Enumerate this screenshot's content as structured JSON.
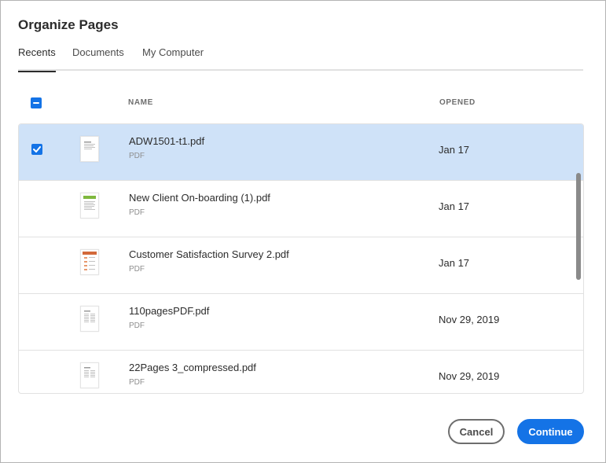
{
  "dialog": {
    "title": "Organize Pages",
    "tabs": [
      {
        "label": "Recents",
        "active": true
      },
      {
        "label": "Documents",
        "active": false
      },
      {
        "label": "My Computer",
        "active": false
      }
    ],
    "columns": {
      "name": "NAME",
      "opened": "OPENED"
    },
    "header_checkbox_state": "indeterminate",
    "files": [
      {
        "name": "ADW1501-t1.pdf",
        "type": "PDF",
        "opened": "Jan 17",
        "selected": true,
        "thumb_icon": "document-thumbnail-icon"
      },
      {
        "name": "New Client On-boarding (1).pdf",
        "type": "PDF",
        "opened": "Jan 17",
        "selected": false,
        "thumb_icon": "document-thumbnail-icon"
      },
      {
        "name": "Customer Satisfaction Survey 2.pdf",
        "type": "PDF",
        "opened": "Jan 17",
        "selected": false,
        "thumb_icon": "survey-thumbnail-icon"
      },
      {
        "name": "110pagesPDF.pdf",
        "type": "PDF",
        "opened": "Nov 29, 2019",
        "selected": false,
        "thumb_icon": "document-thumbnail-icon"
      },
      {
        "name": "22Pages 3_compressed.pdf",
        "type": "PDF",
        "opened": "Nov 29, 2019",
        "selected": false,
        "thumb_icon": "document-thumbnail-icon"
      }
    ],
    "buttons": {
      "cancel": "Cancel",
      "continue": "Continue"
    }
  },
  "colors": {
    "accent": "#1473e6",
    "selected_row": "#cfe2f8"
  }
}
